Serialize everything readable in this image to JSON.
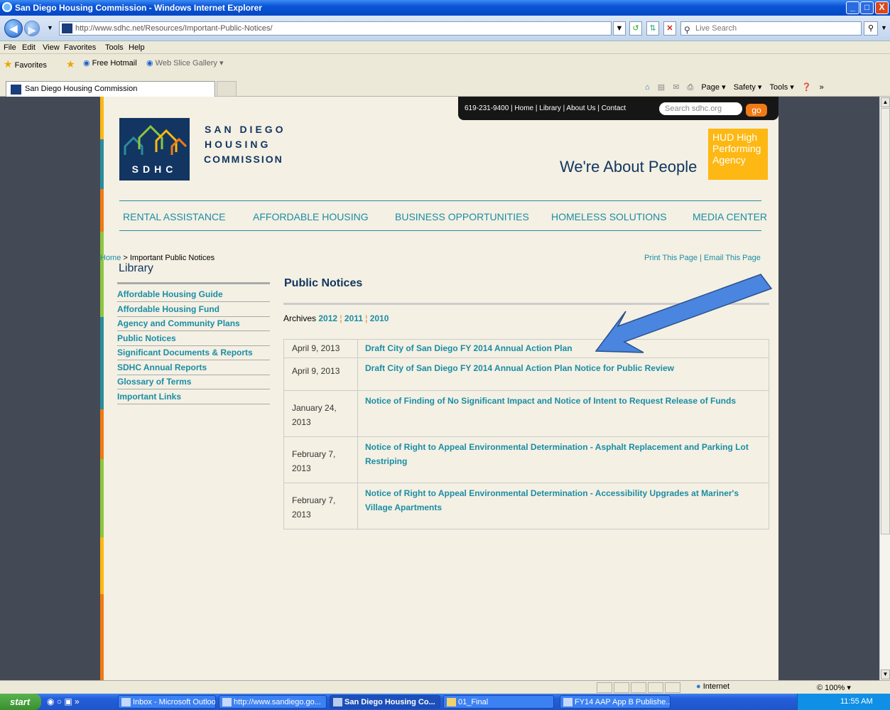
{
  "window": {
    "title": "San Diego Housing Commission - Windows Internet Explorer",
    "min": "_",
    "max": "□",
    "close": "X"
  },
  "address": {
    "url": "http://www.sdhc.net/Resources/Important-Public-Notices/",
    "search_placeholder": "Live Search"
  },
  "menu": [
    "File",
    "Edit",
    "View",
    "Favorites",
    "Tools",
    "Help"
  ],
  "favorites": {
    "label": "Favorites",
    "items": [
      "Free Hotmail",
      "Web Slice Gallery ▾"
    ]
  },
  "tab": {
    "title": "San Diego Housing Commission"
  },
  "commandbar": [
    "Page ▾",
    "Safety ▾",
    "Tools ▾",
    "»"
  ],
  "site": {
    "topbar_links": "619-231-9400  |  Home  |  Library  |  About Us  |  Contact",
    "search_placeholder": "Search sdhc.org",
    "go": "go",
    "logo_line1": "SAN DIEGO",
    "logo_line2": "HOUSING",
    "logo_line3": "COMMISSION",
    "logo_sdhc": "SDHC",
    "slogan": "We're About People",
    "hud": "HUD High Performing Agency",
    "nav": [
      "RENTAL ASSISTANCE",
      "AFFORDABLE HOUSING",
      "BUSINESS OPPORTUNITIES",
      "HOMELESS SOLUTIONS",
      "MEDIA CENTER"
    ],
    "breadcrumb_home": "Home",
    "breadcrumb_rest": " > Important Public Notices",
    "print_links": "Print This Page | Email This Page",
    "sidebar_title": "Library",
    "sidebar_items": [
      "Affordable Housing Guide",
      "Affordable Housing Fund",
      "Agency and Community Plans",
      "Public Notices",
      "Significant Documents & Reports",
      "SDHC Annual Reports",
      "Glossary of Terms",
      "Important Links"
    ],
    "main_title": "Public Notices",
    "archives_label": "Archives",
    "archive_years": [
      "2012",
      "2011",
      "2010"
    ],
    "archive_sep": " ¦ ",
    "notices": [
      {
        "date": "April 9, 2013",
        "title": "Draft City of San Diego FY 2014 Annual Action Plan"
      },
      {
        "date": "April 9, 2013",
        "title": "Draft City of San Diego FY 2014 Annual Action Plan Notice for Public Review"
      },
      {
        "date": "January 24, 2013",
        "title": " Notice of Finding of No Significant Impact and Notice of Intent to Request Release of Funds"
      },
      {
        "date": "February 7, 2013",
        "title": "Notice of Right to Appeal Environmental Determination - Asphalt Replacement and Parking Lot Restriping"
      },
      {
        "date": "February 7, 2013",
        "title": "Notice of Right to Appeal Environmental Determination - Accessibility Upgrades at Mariner's Village Apartments"
      }
    ],
    "annotation_arrow_color": "#4a86e0"
  },
  "statusbar": {
    "zone": "Internet",
    "zoom": "© 100%  ▾"
  },
  "taskbar": {
    "start": "start",
    "tasks": [
      "Inbox - Microsoft Outlook",
      "http://www.sandiego.go...",
      "San Diego Housing Co...",
      "01_Final",
      "FY14 AAP App B Publishe..."
    ],
    "clock": "11:55 AM"
  }
}
